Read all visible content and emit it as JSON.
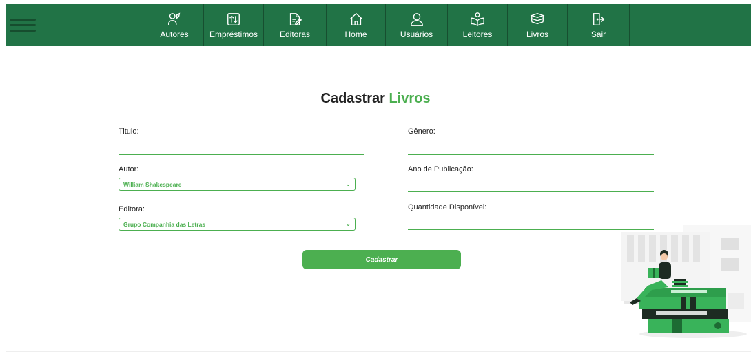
{
  "nav": {
    "menu_icon": "hamburger-menu-icon",
    "items": [
      {
        "label": "Autores",
        "icon": "authors-icon"
      },
      {
        "label": "Empréstimos",
        "icon": "loans-icon"
      },
      {
        "label": "Editoras",
        "icon": "publishers-icon"
      },
      {
        "label": "Home",
        "icon": "home-icon"
      },
      {
        "label": "Usuários",
        "icon": "user-icon"
      },
      {
        "label": "Leitores",
        "icon": "readers-icon"
      },
      {
        "label": "Livros",
        "icon": "books-icon"
      },
      {
        "label": "Sair",
        "icon": "logout-icon"
      }
    ]
  },
  "page": {
    "title_part1": "Cadastrar",
    "title_part2": "Livros"
  },
  "form": {
    "titulo_label": "Titulo:",
    "titulo_value": "",
    "genero_label": "Gênero:",
    "genero_value": "",
    "autor_label": "Autor:",
    "autor_selected": "William Shakespeare",
    "ano_label": "Ano de Publicação:",
    "ano_value": "",
    "editora_label": "Editora:",
    "editora_selected": "Grupo Companhia das Letras",
    "quantidade_label": "Quantidade Disponível:",
    "quantidade_value": "",
    "submit_label": "Cadastrar"
  },
  "colors": {
    "navbar": "#217346",
    "accent": "#4caf50"
  }
}
